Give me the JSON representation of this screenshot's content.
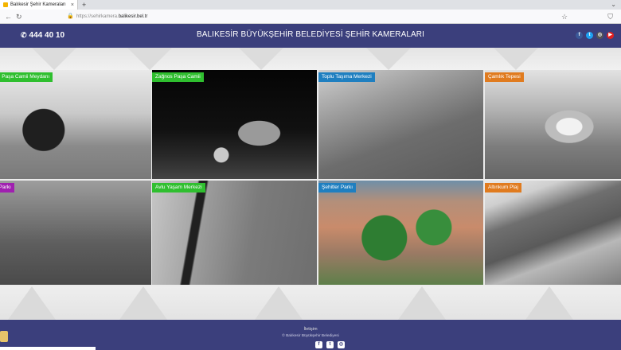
{
  "browser": {
    "tab_title": "Balıkesir Şehir Kameraları",
    "tab_close": "×",
    "new_tab": "+",
    "url_prefix": "https://sehirkamera.",
    "url_domain": "balikesir.bel.tr"
  },
  "header": {
    "phone": "444 40 10",
    "title": "BALIKESİR BÜYÜKŞEHİR BELEDİYESİ ŞEHİR KAMERALARI",
    "social": [
      "f",
      "t",
      "◎",
      "▶"
    ]
  },
  "colors": {
    "brand": "#3b3f7c",
    "label_green": "#2fbf2f",
    "label_blue": "#1f7fc0",
    "label_orange": "#e07b1f",
    "label_purple": "#a020b0",
    "facebook": "#3b5998",
    "twitter": "#1da1f2",
    "instagram": "#555555",
    "youtube": "#e02020"
  },
  "cameras": [
    {
      "label": "...ırcı Paşa Camii Meydanı",
      "color": "#2fbf2f"
    },
    {
      "label": "Zağnos Paşa Camii",
      "color": "#2fbf2f"
    },
    {
      "label": "Toplu Taşıma Merkezi",
      "color": "#1f7fc0"
    },
    {
      "label": "Çamlık Tepesi",
      "color": "#e07b1f"
    },
    {
      "label": "...rk Parkı",
      "color": "#a020b0"
    },
    {
      "label": "Avlu Yaşam Merkezi",
      "color": "#2fbf2f"
    },
    {
      "label": "Şehitler Parkı",
      "color": "#1f7fc0"
    },
    {
      "label": "Altınkum Plaj",
      "color": "#e07b1f"
    }
  ],
  "footer": {
    "title": "İletişim",
    "copyright": "© Balıkesir Büyükşehir Belediyesi",
    "social": [
      "f",
      "t",
      "◎"
    ]
  }
}
